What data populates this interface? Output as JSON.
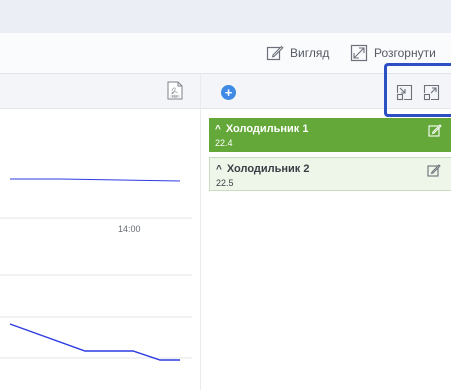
{
  "toolbar": {
    "view_label": "Вигляд",
    "expand_label": "Розгорнути"
  },
  "chart": {
    "time_label": "14:00"
  },
  "devices": [
    {
      "name": "Холодильник 1",
      "value": "22.4",
      "active": true
    },
    {
      "name": "Холодильник 2",
      "value": "22.5",
      "active": false
    }
  ],
  "icons": {
    "pdf": "pdf-icon",
    "add": "plus-icon",
    "collapse": "collapse-icon",
    "expand": "expand-icon",
    "edit": "edit-icon",
    "chevron": "chevron-up-icon"
  },
  "colors": {
    "active_card": "#63a838",
    "line": "#2d3be0",
    "accent": "#3f8ae5",
    "highlight": "#2c4fc4"
  }
}
